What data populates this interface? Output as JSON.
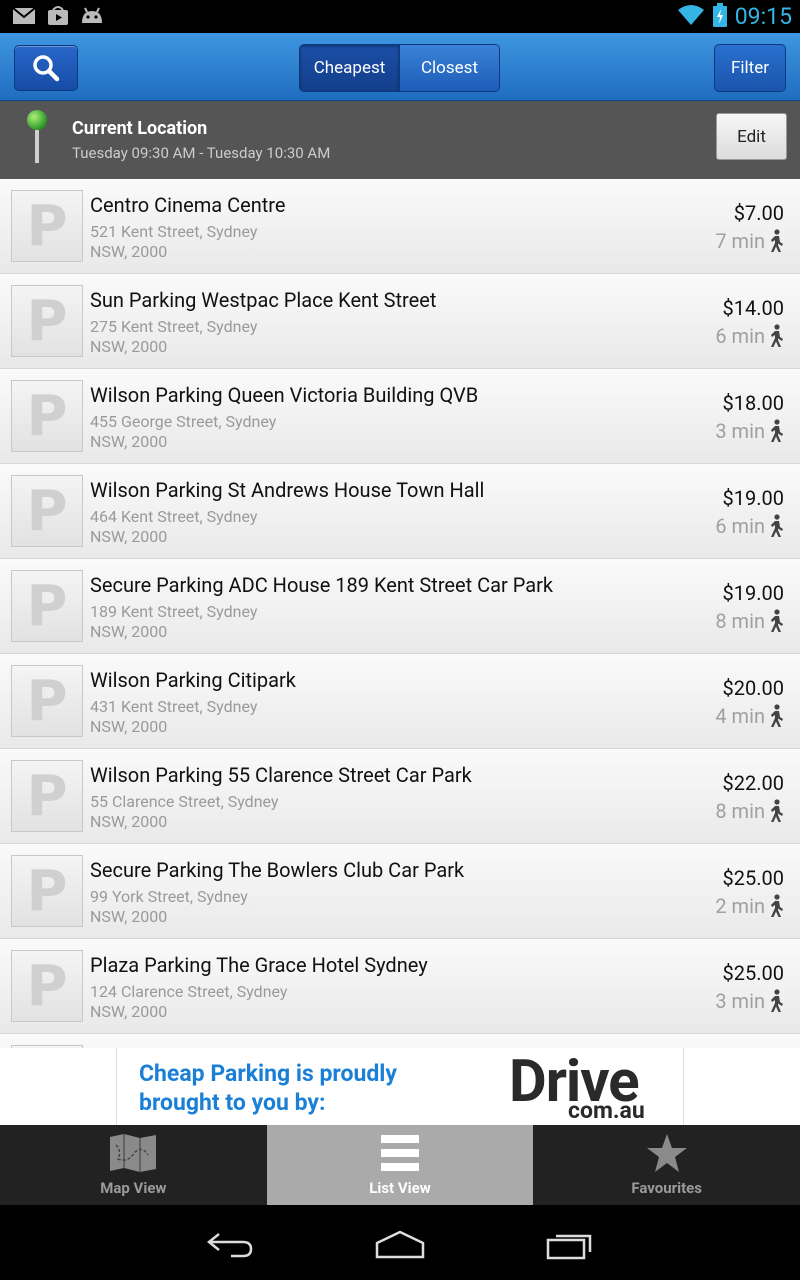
{
  "status_bar": {
    "time": "09:15",
    "icons": [
      "gmail-icon",
      "play-store-icon",
      "android-icon",
      "wifi-icon",
      "battery-charging-icon"
    ]
  },
  "action_bar": {
    "search_icon": "search-icon",
    "sort_options": [
      "Cheapest",
      "Closest"
    ],
    "active_sort": "Cheapest",
    "filter_label": "Filter"
  },
  "location": {
    "title": "Current Location",
    "time_range": "Tuesday 09:30 AM - Tuesday 10:30 AM",
    "edit_label": "Edit",
    "pin_color": "#2fb52f"
  },
  "parking_list": [
    {
      "name": "Centro Cinema Centre",
      "address": "521 Kent Street, Sydney",
      "state": "NSW, 2000",
      "price": "$7.00",
      "walk": "7 min"
    },
    {
      "name": "Sun Parking Westpac Place Kent Street",
      "address": "275 Kent Street, Sydney",
      "state": "NSW, 2000",
      "price": "$14.00",
      "walk": "6 min"
    },
    {
      "name": "Wilson Parking Queen Victoria Building QVB",
      "address": "455 George Street, Sydney",
      "state": "NSW, 2000",
      "price": "$18.00",
      "walk": "3 min"
    },
    {
      "name": "Wilson Parking St Andrews House Town Hall",
      "address": "464 Kent Street, Sydney",
      "state": "NSW, 2000",
      "price": "$19.00",
      "walk": "6 min"
    },
    {
      "name": "Secure Parking ADC House 189 Kent Street Car Park",
      "address": "189 Kent Street, Sydney",
      "state": "NSW, 2000",
      "price": "$19.00",
      "walk": "8 min"
    },
    {
      "name": "Wilson Parking Citipark",
      "address": "431 Kent Street, Sydney",
      "state": "NSW, 2000",
      "price": "$20.00",
      "walk": "4 min"
    },
    {
      "name": "Wilson Parking 55 Clarence Street Car Park",
      "address": "55 Clarence Street, Sydney",
      "state": "NSW, 2000",
      "price": "$22.00",
      "walk": "8 min"
    },
    {
      "name": "Secure Parking The Bowlers Club Car Park",
      "address": "99 York Street, Sydney",
      "state": "NSW, 2000",
      "price": "$25.00",
      "walk": "2 min"
    },
    {
      "name": "Plaza Parking The Grace Hotel Sydney",
      "address": "124 Clarence Street, Sydney",
      "state": "NSW, 2000",
      "price": "$25.00",
      "walk": "3 min"
    }
  ],
  "ad": {
    "line1": "Cheap Parking is proudly",
    "line2": "brought to you by:",
    "logo_main": "Drive",
    "logo_sub": "com.au",
    "text_color": "#1a7fd6"
  },
  "tabs": [
    {
      "label": "Map View",
      "icon": "map-icon",
      "active": false
    },
    {
      "label": "List View",
      "icon": "list-icon",
      "active": true
    },
    {
      "label": "Favourites",
      "icon": "star-icon",
      "active": false
    }
  ],
  "nav_bar": {
    "icons": [
      "back-icon",
      "home-icon",
      "recents-icon"
    ]
  }
}
